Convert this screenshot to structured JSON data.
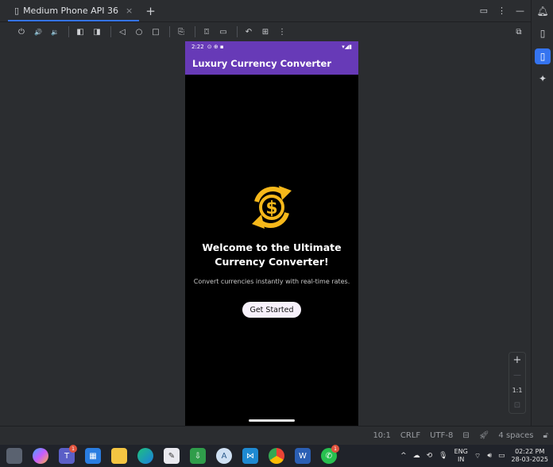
{
  "device_tab": {
    "icon": "device-icon",
    "label": "Medium Phone API 36",
    "close": "×",
    "add": "+"
  },
  "window_controls": {
    "restore": "▭",
    "more": "⋮",
    "minimize": "—"
  },
  "toolbar": {
    "buttons": [
      {
        "name": "power-icon",
        "glyph": "⏻"
      },
      {
        "name": "volume-up-icon",
        "glyph": "🔊"
      },
      {
        "name": "volume-down-icon",
        "glyph": "🔉"
      },
      {
        "name": "rotate-left-icon",
        "glyph": "◧"
      },
      {
        "name": "rotate-right-icon",
        "glyph": "◨"
      },
      {
        "name": "back-icon",
        "glyph": "◁"
      },
      {
        "name": "home-icon",
        "glyph": "○"
      },
      {
        "name": "overview-icon",
        "glyph": "□"
      },
      {
        "name": "fold-icon",
        "glyph": "⎘"
      },
      {
        "name": "screenshot-icon",
        "glyph": "⌼"
      },
      {
        "name": "screen-record-icon",
        "glyph": "▭"
      },
      {
        "name": "snapshot-icon",
        "glyph": "↶"
      },
      {
        "name": "mirroring-icon",
        "glyph": "⊞"
      },
      {
        "name": "more-icon",
        "glyph": "⋮"
      }
    ],
    "right_icon": {
      "name": "device-manager-icon",
      "glyph": "⧉"
    }
  },
  "phone": {
    "status_time": "2:22",
    "status_icons": "⊙ ⊕ ▪",
    "status_right": "▾◢▮",
    "app_title": "Luxury Currency Converter",
    "welcome_line1": "Welcome to the Ultimate",
    "welcome_line2": "Currency Converter!",
    "subtitle": "Convert currencies instantly with real-time rates.",
    "cta_label": "Get Started",
    "accent": "#673ab7",
    "logo_color": "#f6b81a"
  },
  "zoom_panel": {
    "plus": "+",
    "minus": "—",
    "ratio": "1:1",
    "fit": "⊡"
  },
  "ide_status": {
    "position": "10:1",
    "line_sep": "CRLF",
    "encoding": "UTF-8",
    "indent": "4 spaces"
  },
  "taskbar": {
    "teams_badge": "1",
    "whatsapp_badge": "1",
    "lang_top": "ENG",
    "lang_bottom": "IN",
    "time": "02:22 PM",
    "date": "28-03-2025"
  }
}
